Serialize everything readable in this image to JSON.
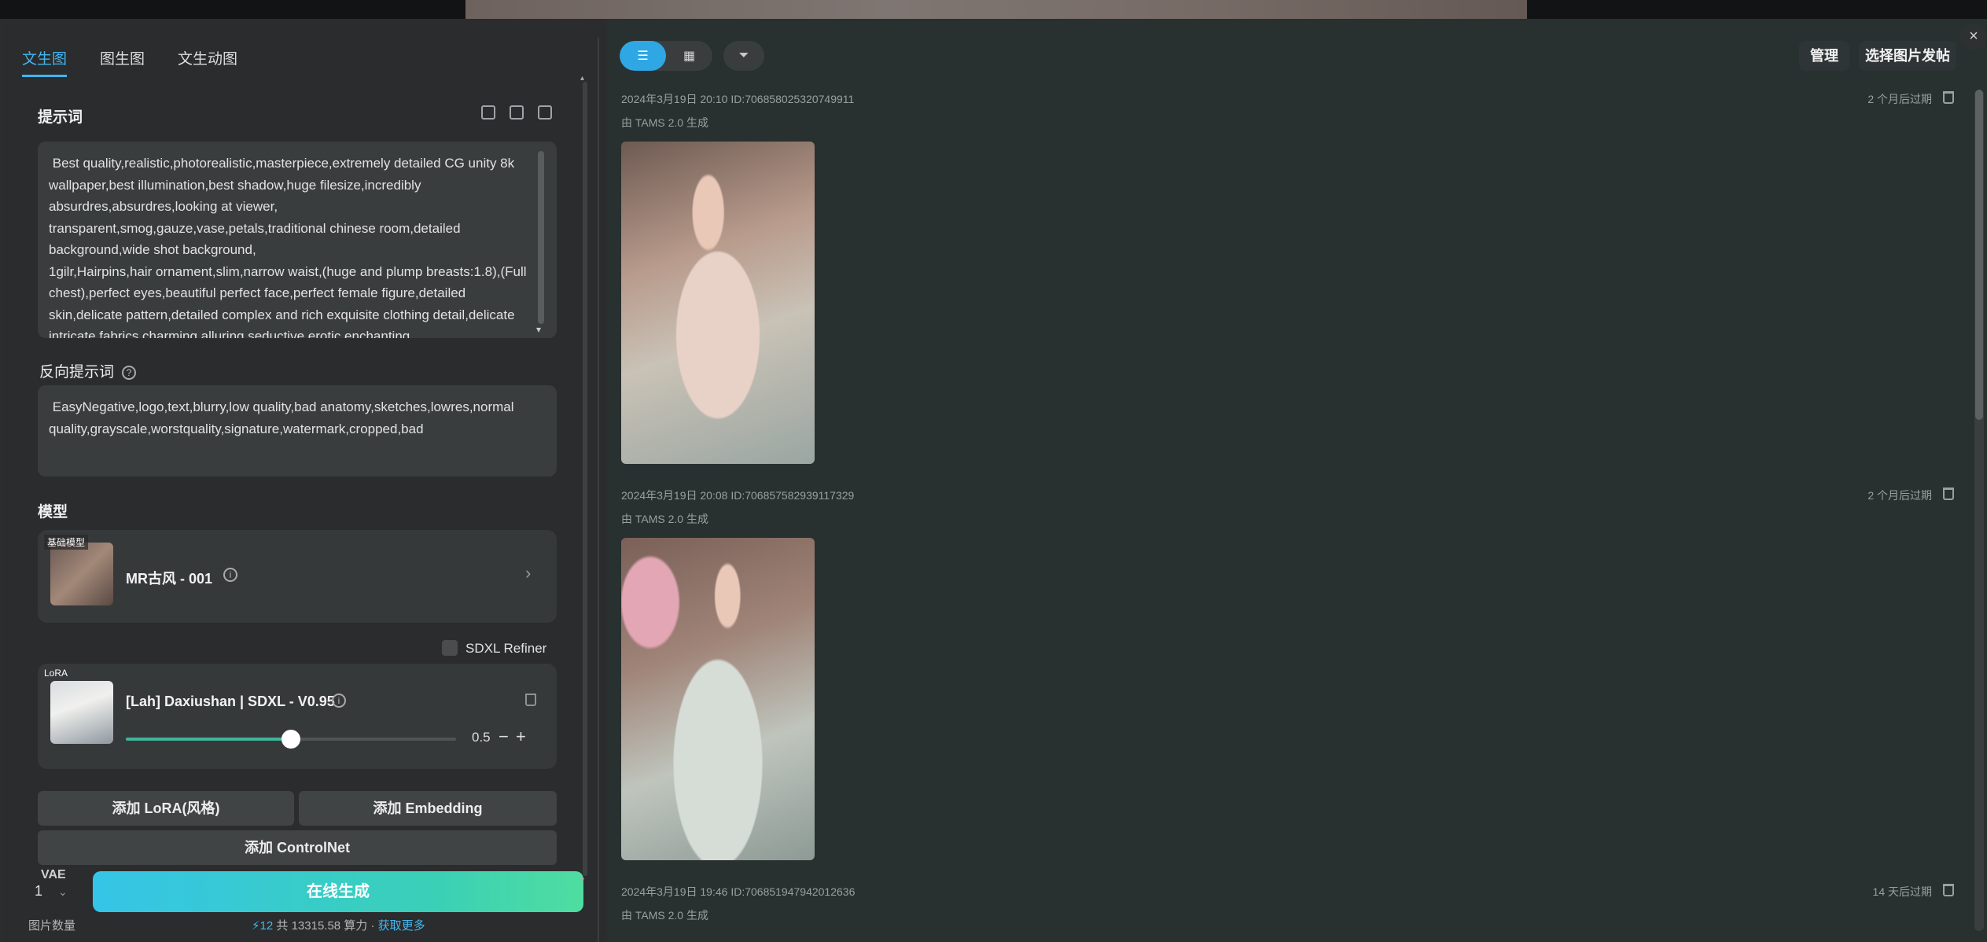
{
  "tabs": [
    {
      "label": "文生图",
      "active": true
    },
    {
      "label": "图生图",
      "active": false
    },
    {
      "label": "文生动图",
      "active": false
    }
  ],
  "prompt": {
    "title": "提示词",
    "text": " Best quality,realistic,photorealistic,masterpiece,extremely detailed CG unity 8k wallpaper,best illumination,best shadow,huge filesize,incredibly absurdres,absurdres,looking at viewer,\ntransparent,smog,gauze,vase,petals,traditional chinese room,detailed background,wide shot background,\n1gilr,Hairpins,hair ornament,slim,narrow waist,(huge and plump breasts:1.8),(Full chest),perfect eyes,beautiful perfect face,perfect female figure,detailed skin,delicate pattern,detailed complex and rich exquisite clothing detail,delicate intricate fabrics,charming,alluring,seductive,erotic,enchanting"
  },
  "negative_prompt": {
    "title": "反向提示词",
    "text": " EasyNegative,logo,text,blurry,low quality,bad anatomy,sketches,lowres,normal quality,grayscale,worstquality,signature,watermark,cropped,bad"
  },
  "model": {
    "title": "模型",
    "tag": "基础模型",
    "name": "MR古风 - 001"
  },
  "sdxl_refiner": {
    "label": "SDXL Refiner",
    "checked": false
  },
  "lora": {
    "tag": "LoRA",
    "name": "[Lah] Daxiushan | SDXL - V0.95",
    "weight": "0.5",
    "weight_fraction": 0.5,
    "minus": "−",
    "plus": "+"
  },
  "buttons": {
    "add_lora": "添加 LoRA(风格)",
    "add_embedding": "添加 Embedding",
    "add_controlnet": "添加 ControlNet",
    "generate": "在线生成"
  },
  "vae_partial": "VAE",
  "image_count": {
    "value": "1",
    "label": "图片数量"
  },
  "credits": {
    "icon": "lightning-icon",
    "cost": "12",
    "text": " 共 13315.58 算力 · ",
    "link": "获取更多"
  },
  "toolbar": {
    "manage": "管理",
    "post": "选择图片发帖",
    "close": "×"
  },
  "records": [
    {
      "meta": "2024年3月19日 20:10 ID:706858025320749911",
      "source": "由 TAMS 2.0 生成",
      "expire": "2 个月后过期"
    },
    {
      "meta": "2024年3月19日 20:08 ID:706857582939117329",
      "source": "由 TAMS 2.0 生成",
      "expire": "2 个月后过期"
    },
    {
      "meta": "2024年3月19日 19:46 ID:706851947942012636",
      "source": "由 TAMS 2.0 生成",
      "expire": "14 天后过期"
    }
  ],
  "colors": {
    "accent": "#3fb6f0",
    "slider": "#3fb49a",
    "generate_gradient": [
      "#35c5e8",
      "#4fdda0"
    ]
  }
}
